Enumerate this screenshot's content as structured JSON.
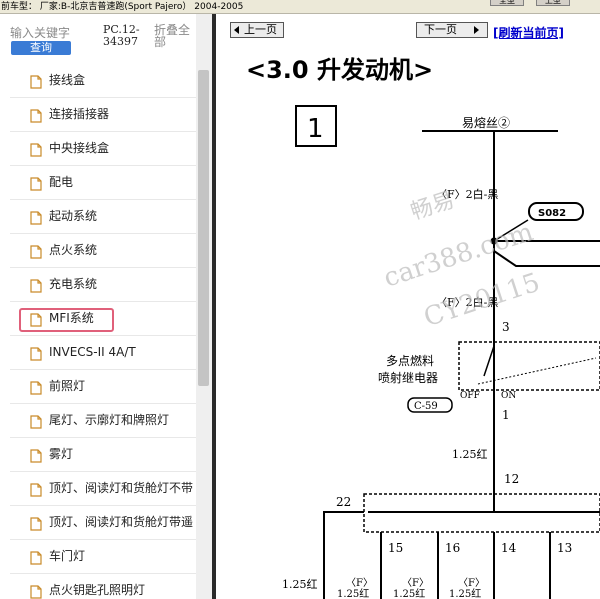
{
  "top": {
    "vehicle_line": "前车型：  厂家:B-北京吉普速跑(Sport Pajero）  2004-2005",
    "buttons": [
      "全型",
      "上型"
    ]
  },
  "sidebar": {
    "search_hint": "输入关键字",
    "query_label": "查询",
    "pc_code": "PC.12-34397",
    "collapse_label": "折叠全部",
    "items": [
      {
        "label": "接线盒"
      },
      {
        "label": "连接插接器"
      },
      {
        "label": "中央接线盒"
      },
      {
        "label": "配电"
      },
      {
        "label": "起动系统"
      },
      {
        "label": "点火系统"
      },
      {
        "label": "充电系统"
      },
      {
        "label": "MFI系统",
        "selected": true
      },
      {
        "label": "INVECS-II 4A/T"
      },
      {
        "label": "前照灯"
      },
      {
        "label": "尾灯、示廓灯和牌照灯"
      },
      {
        "label": "雾灯"
      },
      {
        "label": "顶灯、阅读灯和货舱灯不带"
      },
      {
        "label": "顶灯、阅读灯和货舱灯带遥"
      },
      {
        "label": "车门灯"
      },
      {
        "label": "点火钥匙孔照明灯"
      }
    ]
  },
  "toolbar": {
    "prev_label": "上一页",
    "next_label": "下一页",
    "refresh_label": "[刷新当前页]"
  },
  "diagram": {
    "title": "<3.0 升发动机>",
    "box_number": "1",
    "fuse_label": "易熔丝②",
    "wire_upper": "〈F〉2白-黑",
    "splice_label": "S082",
    "wire_mid": "〈F〉2白-黑",
    "pin_3": "3",
    "relay_name_line1": "多点燃料",
    "relay_name_line2": "喷射继电器",
    "relay_off": "OFF",
    "relay_on": "ON",
    "connector": "C-59",
    "pin_1": "1",
    "wire_lower": "1.25红",
    "pin_12": "12",
    "pin_22": "22",
    "pin_15": "15",
    "pin_16": "16",
    "pin_14": "14",
    "pin_13": "13",
    "bottom_left_wire": "1.25红",
    "bottom_f1": "〈F〉",
    "bottom_f2": "〈F〉",
    "bottom_f3": "〈F〉",
    "bottom_wire2": "1.25红",
    "bottom_wire3": "1.25红",
    "bottom_wire4": "1.25红",
    "watermark_1": "畅易",
    "watermark_2": "car388.com",
    "watermark_3": "CY20115"
  },
  "colors": {
    "accent_button": "#3a7bd5",
    "selection_border": "#e0607a",
    "link": "#0000cc"
  }
}
